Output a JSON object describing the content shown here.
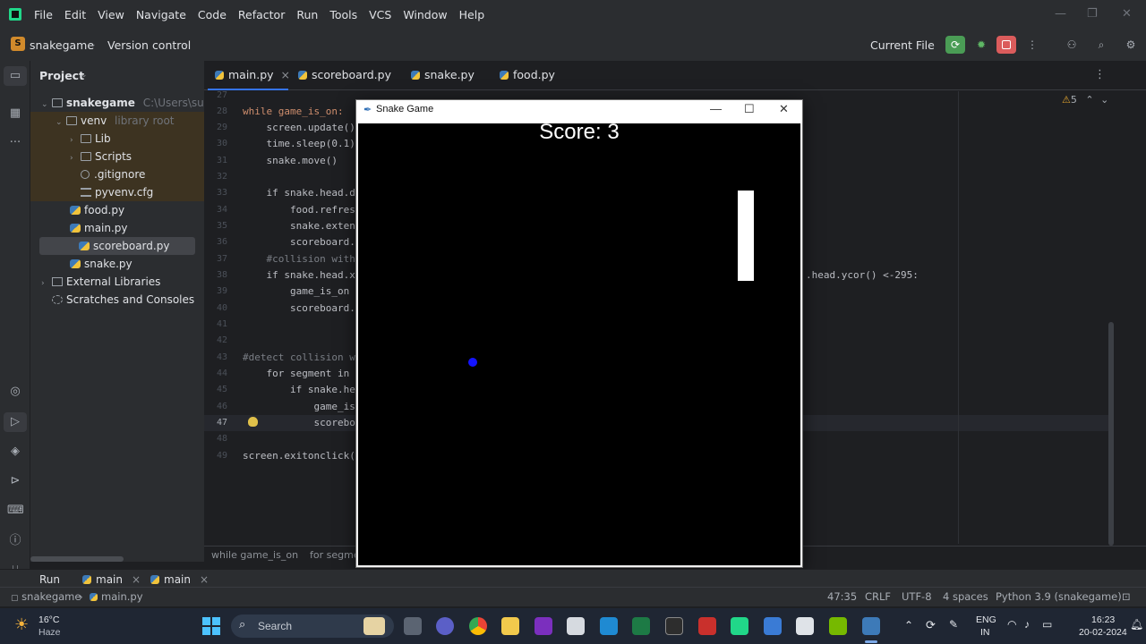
{
  "menu": [
    "File",
    "Edit",
    "View",
    "Navigate",
    "Code",
    "Refactor",
    "Run",
    "Tools",
    "VCS",
    "Window",
    "Help"
  ],
  "toolbar": {
    "project_initial": "S",
    "project_name": "snakegame",
    "version_control": "Version control",
    "run_config": "Current File"
  },
  "project_panel": {
    "title": "Project",
    "root_name": "snakegame",
    "root_path": "C:\\Users\\sumit\\",
    "venv_name": "venv",
    "venv_hint": "library root",
    "items": [
      "Lib",
      "Scripts",
      ".gitignore",
      "pyvenv.cfg",
      "food.py",
      "main.py",
      "scoreboard.py",
      "snake.py"
    ],
    "external": "External Libraries",
    "scratches": "Scratches and Consoles"
  },
  "tabs": [
    "main.py",
    "scoreboard.py",
    "snake.py",
    "food.py"
  ],
  "editor": {
    "warnings": "5",
    "line_numbers": [
      "27",
      "28",
      "29",
      "30",
      "31",
      "32",
      "33",
      "34",
      "35",
      "36",
      "37",
      "38",
      "39",
      "40",
      "41",
      "42",
      "43",
      "44",
      "45",
      "46",
      "47",
      "48",
      "49"
    ],
    "lines": {
      "l28": "while game_is_on:",
      "l29": "    screen.update()",
      "l30": "    time.sleep(0.1)",
      "l31": "    snake.move()",
      "l33": "    if snake.head.d",
      "l34": "        food.refres",
      "l35": "        snake.exten",
      "l36": "        scoreboard.",
      "l37": "    #collision with",
      "l38": "    if snake.head.x",
      "l38_right": ".head.ycor() <-295:",
      "l39": "        game_is_on ",
      "l40": "        scoreboard.",
      "l43": "#detect collision w",
      "l44": "    for segment in ",
      "l45": "        if snake.he",
      "l46": "            game_is",
      "l47": "            scorebo",
      "l49": "screen.exitonclick("
    }
  },
  "breadcrumb": [
    "while game_is_on",
    "for segme"
  ],
  "game": {
    "title": "Snake Game",
    "score_text": "Score: 3"
  },
  "runbar": {
    "label": "Run",
    "tabs": [
      "main",
      "main"
    ]
  },
  "status": {
    "path": [
      "snakegame",
      "main.py"
    ],
    "position": "47:35",
    "line_sep": "CRLF",
    "encoding": "UTF-8",
    "indent": "4 spaces",
    "interpreter": "Python 3.9 (snakegame)"
  },
  "taskbar": {
    "temp": "16°C",
    "weather": "Haze",
    "search": "Search",
    "lang": "ENG",
    "region": "IN",
    "time": "16:23",
    "date": "20-02-2024"
  },
  "colors": {
    "ide_bg": "#1e1f22",
    "panel_bg": "#2b2d30",
    "accent": "#3574f0",
    "run_green": "#4a9c55",
    "stop_red": "#db5c5c",
    "food": "#1414ff"
  }
}
